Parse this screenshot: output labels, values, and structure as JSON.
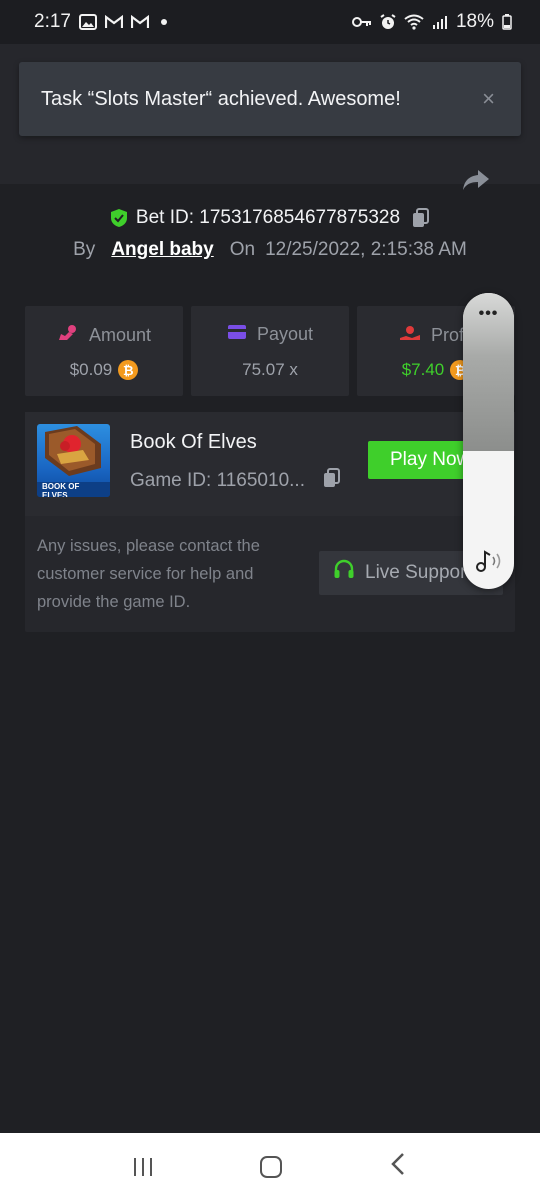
{
  "status_bar": {
    "time": "2:17",
    "battery": "18%",
    "icons": [
      "image-icon",
      "gmail-icon",
      "gmail-icon",
      "dot-icon",
      "key-icon",
      "alarm-icon",
      "wifi-icon",
      "signal-icon",
      "battery-icon"
    ]
  },
  "toast": {
    "message": "Task “Slots Master“ achieved. Awesome!",
    "close_label": "×"
  },
  "bet": {
    "id_label": "Bet ID: 1753176854677875328",
    "by_label": "By",
    "user": "Angel baby",
    "on_label": "On",
    "date": "12/25/2022, 2:15:38 AM"
  },
  "stats": [
    {
      "label": "Amount",
      "value": "$0.09",
      "coin": "₿",
      "color": "#9ea2aa"
    },
    {
      "label": "Payout",
      "value": "75.07 x"
    },
    {
      "label": "Profit",
      "value": "$7.40",
      "coin": "₿",
      "color": "#3fcf2b"
    }
  ],
  "game": {
    "name": "Book Of Elves",
    "id_label": "Game ID: 1165010...",
    "thumb_text": "BOOK OF ELVES",
    "play_label": "Play Now",
    "help_text": "Any issues, please contact the customer service for help and provide the game ID.",
    "live_support_label": "Live Support"
  },
  "volume": {
    "dots": "•••",
    "level": 0.47
  },
  "colors": {
    "accent_green": "#3fcf2b",
    "background": "#1f2024",
    "card": "#2a2b30"
  }
}
